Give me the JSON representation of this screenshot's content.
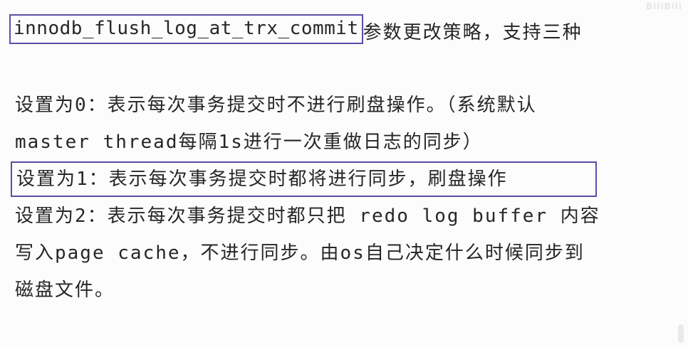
{
  "lines": [
    {
      "highlight": "innodb_flush_log_at_trx_commit",
      "rest": "参数更改策略，支持三种"
    },
    {
      "text": "设置为0：表示每次事务提交时不进行刷盘操作。（系统默认"
    },
    {
      "text": "master thread每隔1s进行一次重做日志的同步）"
    },
    {
      "text": "设置为1：表示每次事务提交时都将进行同步，刷盘操作"
    },
    {
      "text": "设置为2：表示每次事务提交时都只把 redo log buffer 内容"
    },
    {
      "text": "写入page cache，不进行同步。由os自己决定什么时候同步到"
    },
    {
      "text": "磁盘文件。"
    }
  ],
  "watermark": "BiliBili"
}
